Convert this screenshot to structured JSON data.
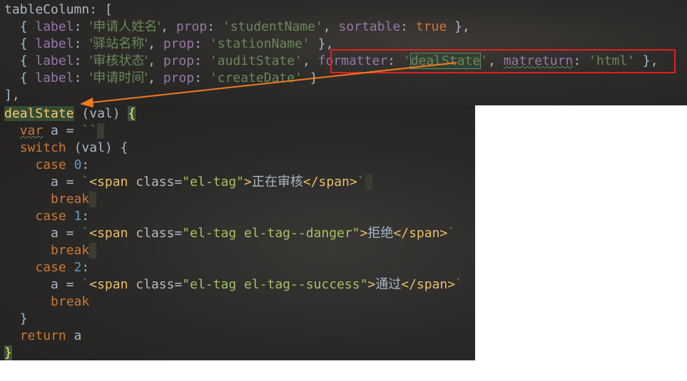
{
  "top": {
    "line1": "tableColumn: [",
    "rows": [
      {
        "label_key": "label",
        "label_value": "'申请人姓名'",
        "prop_key": "prop",
        "prop_value": "'studentName'",
        "extra_key": "sortable",
        "extra_value": "true"
      },
      {
        "label_key": "label",
        "label_value": "'驿站名称'",
        "prop_key": "prop",
        "prop_value": "'stationName'"
      },
      {
        "label_key": "label",
        "label_value": "'审核状态'",
        "prop_key": "prop",
        "prop_value": "'auditState'",
        "formatter_key": "formatter",
        "formatter_value": "dealState",
        "matreturn_key": "matreturn",
        "matreturn_value": "'html'"
      },
      {
        "label_key": "label",
        "label_value": "'申请时间'",
        "prop_key": "prop",
        "prop_value": "'createDate'"
      }
    ],
    "closing": "],"
  },
  "bottom": {
    "fn_name": "dealState",
    "fn_params": "(val)",
    "var_kw": "var",
    "var_name": "a",
    "switch_kw": "switch",
    "switch_arg": "(val)",
    "case_kw": "case",
    "break_kw": "break",
    "return_kw": "return",
    "cases": [
      {
        "num": "0",
        "cls": "el-tag",
        "text": "正在审核"
      },
      {
        "num": "1",
        "cls": "el-tag el-tag--danger",
        "text": "拒绝"
      },
      {
        "num": "2",
        "cls": "el-tag el-tag--success",
        "text": "通过"
      }
    ]
  },
  "annotation": {
    "box_color": "#e02020",
    "arrow_color": "#f07a20"
  }
}
